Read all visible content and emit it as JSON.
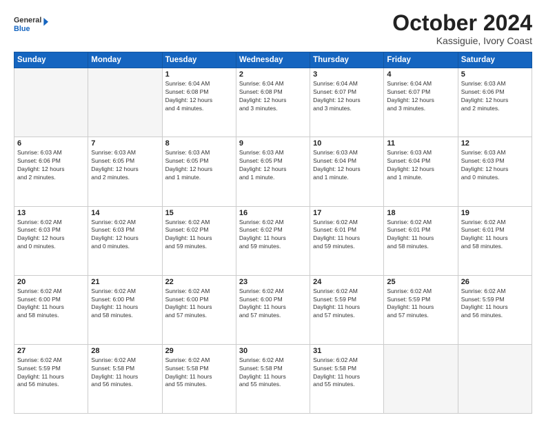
{
  "logo": {
    "line1": "General",
    "line2": "Blue"
  },
  "title": "October 2024",
  "subtitle": "Kassiguie, Ivory Coast",
  "header_days": [
    "Sunday",
    "Monday",
    "Tuesday",
    "Wednesday",
    "Thursday",
    "Friday",
    "Saturday"
  ],
  "weeks": [
    [
      {
        "day": "",
        "info": ""
      },
      {
        "day": "",
        "info": ""
      },
      {
        "day": "1",
        "info": "Sunrise: 6:04 AM\nSunset: 6:08 PM\nDaylight: 12 hours\nand 4 minutes."
      },
      {
        "day": "2",
        "info": "Sunrise: 6:04 AM\nSunset: 6:08 PM\nDaylight: 12 hours\nand 3 minutes."
      },
      {
        "day": "3",
        "info": "Sunrise: 6:04 AM\nSunset: 6:07 PM\nDaylight: 12 hours\nand 3 minutes."
      },
      {
        "day": "4",
        "info": "Sunrise: 6:04 AM\nSunset: 6:07 PM\nDaylight: 12 hours\nand 3 minutes."
      },
      {
        "day": "5",
        "info": "Sunrise: 6:03 AM\nSunset: 6:06 PM\nDaylight: 12 hours\nand 2 minutes."
      }
    ],
    [
      {
        "day": "6",
        "info": "Sunrise: 6:03 AM\nSunset: 6:06 PM\nDaylight: 12 hours\nand 2 minutes."
      },
      {
        "day": "7",
        "info": "Sunrise: 6:03 AM\nSunset: 6:05 PM\nDaylight: 12 hours\nand 2 minutes."
      },
      {
        "day": "8",
        "info": "Sunrise: 6:03 AM\nSunset: 6:05 PM\nDaylight: 12 hours\nand 1 minute."
      },
      {
        "day": "9",
        "info": "Sunrise: 6:03 AM\nSunset: 6:05 PM\nDaylight: 12 hours\nand 1 minute."
      },
      {
        "day": "10",
        "info": "Sunrise: 6:03 AM\nSunset: 6:04 PM\nDaylight: 12 hours\nand 1 minute."
      },
      {
        "day": "11",
        "info": "Sunrise: 6:03 AM\nSunset: 6:04 PM\nDaylight: 12 hours\nand 1 minute."
      },
      {
        "day": "12",
        "info": "Sunrise: 6:03 AM\nSunset: 6:03 PM\nDaylight: 12 hours\nand 0 minutes."
      }
    ],
    [
      {
        "day": "13",
        "info": "Sunrise: 6:02 AM\nSunset: 6:03 PM\nDaylight: 12 hours\nand 0 minutes."
      },
      {
        "day": "14",
        "info": "Sunrise: 6:02 AM\nSunset: 6:03 PM\nDaylight: 12 hours\nand 0 minutes."
      },
      {
        "day": "15",
        "info": "Sunrise: 6:02 AM\nSunset: 6:02 PM\nDaylight: 11 hours\nand 59 minutes."
      },
      {
        "day": "16",
        "info": "Sunrise: 6:02 AM\nSunset: 6:02 PM\nDaylight: 11 hours\nand 59 minutes."
      },
      {
        "day": "17",
        "info": "Sunrise: 6:02 AM\nSunset: 6:01 PM\nDaylight: 11 hours\nand 59 minutes."
      },
      {
        "day": "18",
        "info": "Sunrise: 6:02 AM\nSunset: 6:01 PM\nDaylight: 11 hours\nand 58 minutes."
      },
      {
        "day": "19",
        "info": "Sunrise: 6:02 AM\nSunset: 6:01 PM\nDaylight: 11 hours\nand 58 minutes."
      }
    ],
    [
      {
        "day": "20",
        "info": "Sunrise: 6:02 AM\nSunset: 6:00 PM\nDaylight: 11 hours\nand 58 minutes."
      },
      {
        "day": "21",
        "info": "Sunrise: 6:02 AM\nSunset: 6:00 PM\nDaylight: 11 hours\nand 58 minutes."
      },
      {
        "day": "22",
        "info": "Sunrise: 6:02 AM\nSunset: 6:00 PM\nDaylight: 11 hours\nand 57 minutes."
      },
      {
        "day": "23",
        "info": "Sunrise: 6:02 AM\nSunset: 6:00 PM\nDaylight: 11 hours\nand 57 minutes."
      },
      {
        "day": "24",
        "info": "Sunrise: 6:02 AM\nSunset: 5:59 PM\nDaylight: 11 hours\nand 57 minutes."
      },
      {
        "day": "25",
        "info": "Sunrise: 6:02 AM\nSunset: 5:59 PM\nDaylight: 11 hours\nand 57 minutes."
      },
      {
        "day": "26",
        "info": "Sunrise: 6:02 AM\nSunset: 5:59 PM\nDaylight: 11 hours\nand 56 minutes."
      }
    ],
    [
      {
        "day": "27",
        "info": "Sunrise: 6:02 AM\nSunset: 5:59 PM\nDaylight: 11 hours\nand 56 minutes."
      },
      {
        "day": "28",
        "info": "Sunrise: 6:02 AM\nSunset: 5:58 PM\nDaylight: 11 hours\nand 56 minutes."
      },
      {
        "day": "29",
        "info": "Sunrise: 6:02 AM\nSunset: 5:58 PM\nDaylight: 11 hours\nand 55 minutes."
      },
      {
        "day": "30",
        "info": "Sunrise: 6:02 AM\nSunset: 5:58 PM\nDaylight: 11 hours\nand 55 minutes."
      },
      {
        "day": "31",
        "info": "Sunrise: 6:02 AM\nSunset: 5:58 PM\nDaylight: 11 hours\nand 55 minutes."
      },
      {
        "day": "",
        "info": ""
      },
      {
        "day": "",
        "info": ""
      }
    ]
  ]
}
